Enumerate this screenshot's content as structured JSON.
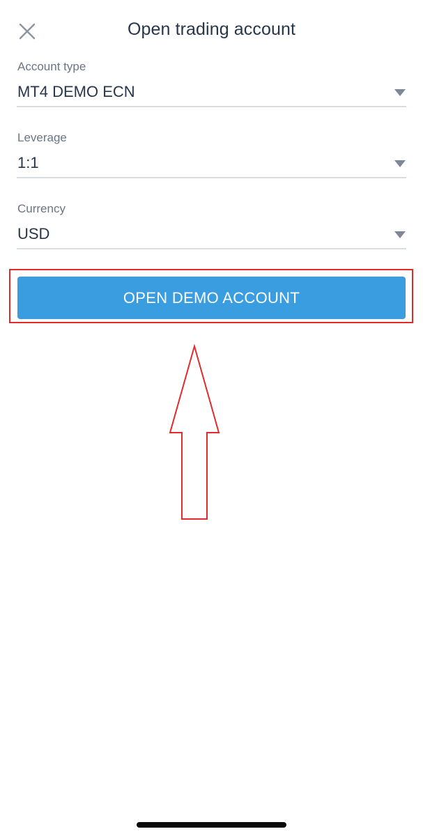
{
  "header": {
    "title": "Open trading account",
    "close_icon": "close-icon"
  },
  "form": {
    "fields": [
      {
        "label": "Account type",
        "value": "MT4 DEMO ECN"
      },
      {
        "label": "Leverage",
        "value": "1:1"
      },
      {
        "label": "Currency",
        "value": "USD"
      }
    ],
    "submit_label": "OPEN DEMO ACCOUNT"
  },
  "annotation": {
    "highlight_color": "#e02b2b",
    "arrow_direction": "up"
  },
  "colors": {
    "accent": "#3a9de0",
    "text": "#27364a",
    "muted": "#6a7584"
  }
}
